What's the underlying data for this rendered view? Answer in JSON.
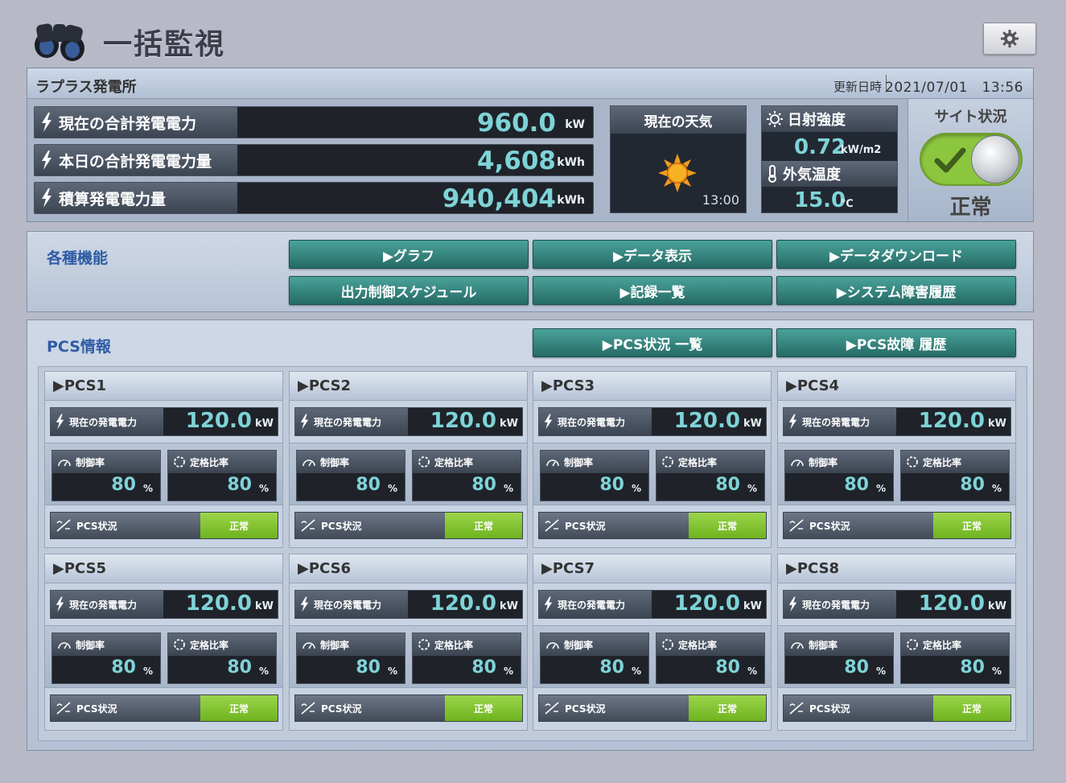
{
  "header": {
    "title": "一括監視",
    "icon": "binoculars-icon",
    "settings_icon": "gear-icon"
  },
  "site": {
    "name": "ラプラス発電所",
    "update_label": "更新日時",
    "update_value": "2021/07/01　13:56",
    "metrics": [
      {
        "label": "現在の合計発電電力",
        "value": "960.0",
        "unit": "kW"
      },
      {
        "label": "本日の合計発電電力量",
        "value": "4,608",
        "unit": "kWh"
      },
      {
        "label": "積算発電電力量",
        "value": "940,404",
        "unit": "kWh"
      }
    ],
    "weather": {
      "title": "現在の天気",
      "time": "13:00",
      "icon": "sun-icon"
    },
    "irradiance": {
      "label": "日射強度",
      "value": "0.72",
      "unit": "kW/m2"
    },
    "temperature": {
      "label": "外気温度",
      "value": "15.0",
      "unit": "℃"
    },
    "status": {
      "title": "サイト状況",
      "value": "正常"
    }
  },
  "functions": {
    "title": "各種機能",
    "buttons": [
      "▶グラフ",
      "▶データ表示",
      "▶データダウンロード",
      "出力制御スケジュール",
      "▶記録一覧",
      "▶システム障害履歴"
    ]
  },
  "pcs": {
    "title": "PCS情報",
    "buttons": [
      "▶PCS状況 一覧",
      "▶PCS故障 履歴"
    ],
    "power_label": "現在の発電電力",
    "control_label": "制御率",
    "ratio_label": "定格比率",
    "state_label": "PCS状況",
    "units": [
      {
        "name": "▶PCS1",
        "power": "120.0",
        "power_unit": "kW",
        "control": "80",
        "ratio": "80",
        "pct": "%",
        "state": "正常"
      },
      {
        "name": "▶PCS2",
        "power": "120.0",
        "power_unit": "kW",
        "control": "80",
        "ratio": "80",
        "pct": "%",
        "state": "正常"
      },
      {
        "name": "▶PCS3",
        "power": "120.0",
        "power_unit": "kW",
        "control": "80",
        "ratio": "80",
        "pct": "%",
        "state": "正常"
      },
      {
        "name": "▶PCS4",
        "power": "120.0",
        "power_unit": "kW",
        "control": "80",
        "ratio": "80",
        "pct": "%",
        "state": "正常"
      },
      {
        "name": "▶PCS5",
        "power": "120.0",
        "power_unit": "kW",
        "control": "80",
        "ratio": "80",
        "pct": "%",
        "state": "正常"
      },
      {
        "name": "▶PCS6",
        "power": "120.0",
        "power_unit": "kW",
        "control": "80",
        "ratio": "80",
        "pct": "%",
        "state": "正常"
      },
      {
        "name": "▶PCS7",
        "power": "120.0",
        "power_unit": "kW",
        "control": "80",
        "ratio": "80",
        "pct": "%",
        "state": "正常"
      },
      {
        "name": "▶PCS8",
        "power": "120.0",
        "power_unit": "kW",
        "control": "80",
        "ratio": "80",
        "pct": "%",
        "state": "正常"
      }
    ]
  },
  "colors": {
    "value": "#7ed3d7",
    "button": "#2f7d77",
    "status_ok": "#8cc63f",
    "section_title": "#2e5ca5"
  }
}
